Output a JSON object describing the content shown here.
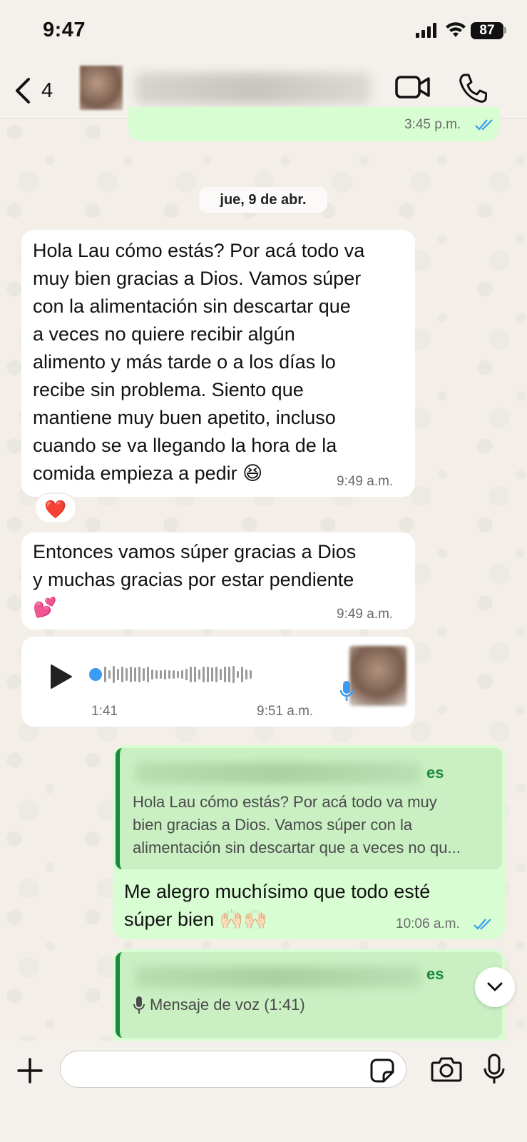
{
  "status_bar": {
    "time": "9:47",
    "battery": "87"
  },
  "header": {
    "back_count": "4"
  },
  "messages": {
    "prev_time": "3:45 p.m.",
    "date_chip": "jue, 9 de abr.",
    "m1": {
      "lines": [
        "Hola Lau cómo estás? Por acá todo va",
        "muy bien gracias a Dios. Vamos súper",
        "con la alimentación sin descartar que",
        "a veces no quiere recibir algún",
        "alimento y más tarde o a los días lo",
        "recibe sin problema. Siento que",
        "mantiene muy buen apetito, incluso",
        "cuando se va llegando la hora de la",
        "comida empieza a pedir 😆"
      ],
      "time": "9:49 a.m.",
      "reaction": "❤️"
    },
    "m2": {
      "lines": [
        "Entonces vamos súper gracias a Dios",
        "y muchas gracias por estar pendiente",
        "💕"
      ],
      "time": "9:49 a.m."
    },
    "audio": {
      "duration": "1:41",
      "time": "9:51 a.m."
    },
    "reply1": {
      "quote_author_tail": "es",
      "quote_lines": [
        "Hola Lau cómo estás? Por acá todo va muy",
        "bien gracias a Dios. Vamos súper con la",
        "alimentación sin descartar que a veces no qu..."
      ],
      "lines": [
        "Me alegro muchísimo que todo esté",
        "súper bien 🙌🏻🙌🏻"
      ],
      "time": "10:06 a.m."
    },
    "reply2": {
      "quote_author_tail": "es",
      "quote_text": "Mensaje de voz (1:41)"
    }
  },
  "input": {
    "placeholder": ""
  },
  "colors": {
    "outgoing": "#d8fdd2",
    "incoming": "#ffffff",
    "accent": "#1b8a3c",
    "tick": "#3a9bf0"
  }
}
